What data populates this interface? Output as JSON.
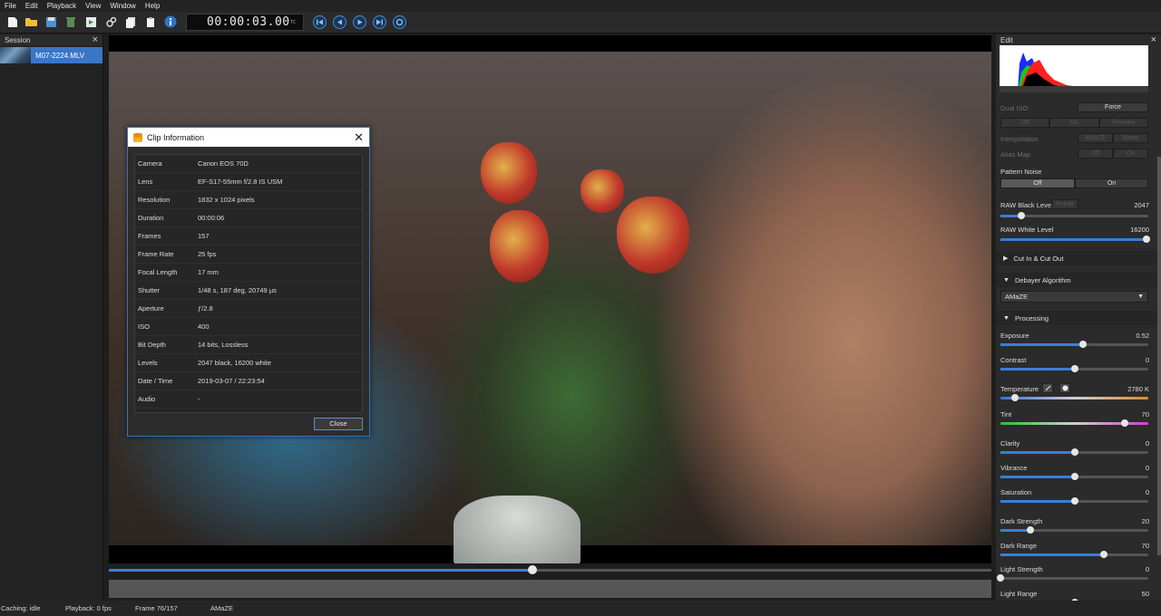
{
  "menu": [
    "File",
    "Edit",
    "Playback",
    "View",
    "Window",
    "Help"
  ],
  "toolbar": {
    "timecode": "00:00:03.00",
    "tc_label": "TC"
  },
  "session": {
    "title": "Session",
    "close": "×",
    "clips": [
      {
        "name": "M07-2224.MLV"
      }
    ]
  },
  "dialog": {
    "title": "Clip Information",
    "close": "✕",
    "close_button": "Close",
    "rows": [
      {
        "key": "Camera",
        "value": "Canon EOS 70D"
      },
      {
        "key": "Lens",
        "value": "EF-S17-55mm f/2.8 IS USM"
      },
      {
        "key": "Resolution",
        "value": "1832 x 1024 pixels"
      },
      {
        "key": "Duration",
        "value": "00:00:06"
      },
      {
        "key": "Frames",
        "value": "157"
      },
      {
        "key": "Frame Rate",
        "value": "25 fps"
      },
      {
        "key": "Focal Length",
        "value": "17 mm"
      },
      {
        "key": "Shutter",
        "value": "1/48 s,  187 deg,  20749 µs"
      },
      {
        "key": "Aperture",
        "value": "ƒ/2.8"
      },
      {
        "key": "ISO",
        "value": "400"
      },
      {
        "key": "Bit Depth",
        "value": "14 bits,  Lossless"
      },
      {
        "key": "Levels",
        "value": "2047 black,  16200 white"
      },
      {
        "key": "Date / Time",
        "value": "2019-03-07 / 22:23:54"
      },
      {
        "key": "Audio",
        "value": "-"
      }
    ]
  },
  "timeline": {
    "position": 0.48
  },
  "status": {
    "caching": "Caching: idle",
    "playback": "Playback: 0 fps",
    "frame": "Frame 76/157",
    "debayer": "AMaZE"
  },
  "edit": {
    "title": "Edit",
    "close": "×",
    "dual_iso": {
      "label": "Dual ISO",
      "force": "Force",
      "options": [
        "Off",
        "On",
        "Preview"
      ]
    },
    "interpolation": {
      "label": "Interpolation",
      "options": [
        "AMaZE",
        "Mean"
      ]
    },
    "alias_map": {
      "label": "Alias Map",
      "options": [
        "Off",
        "On"
      ]
    },
    "pattern_noise": {
      "label": "Pattern Noise",
      "options": [
        "Off",
        "On"
      ]
    },
    "raw_black": {
      "label": "RAW Black Level",
      "repair": "Repair",
      "value": "2047",
      "pos": 0.14
    },
    "raw_white": {
      "label": "RAW White Level",
      "value": "16200",
      "pos": 0.99
    },
    "cut_section": "Cut In & Cut Out",
    "debayer_section": "Debayer Algorithm",
    "debayer_value": "AMaZE",
    "processing_section": "Processing",
    "sliders": [
      {
        "label": "Exposure",
        "value": "0.52",
        "pos": 0.56
      },
      {
        "label": "Contrast",
        "value": "0",
        "pos": 0.5
      },
      {
        "label": "Temperature",
        "value": "2780 K",
        "pos": 0.1,
        "special": "temp"
      },
      {
        "label": "Tint",
        "value": "70",
        "pos": 0.84,
        "special": "tint"
      },
      {
        "label": "Clarity",
        "value": "0",
        "pos": 0.5
      },
      {
        "label": "Vibrance",
        "value": "0",
        "pos": 0.5
      },
      {
        "label": "Saturation",
        "value": "0",
        "pos": 0.5
      },
      {
        "label": "Dark Strength",
        "value": "20",
        "pos": 0.2
      },
      {
        "label": "Dark Range",
        "value": "70",
        "pos": 0.7
      },
      {
        "label": "Light Strength",
        "value": "0",
        "pos": 0.0
      },
      {
        "label": "Light Range",
        "value": "50",
        "pos": 0.5
      }
    ],
    "colors": {
      "accent": "#3a7ed8"
    }
  }
}
